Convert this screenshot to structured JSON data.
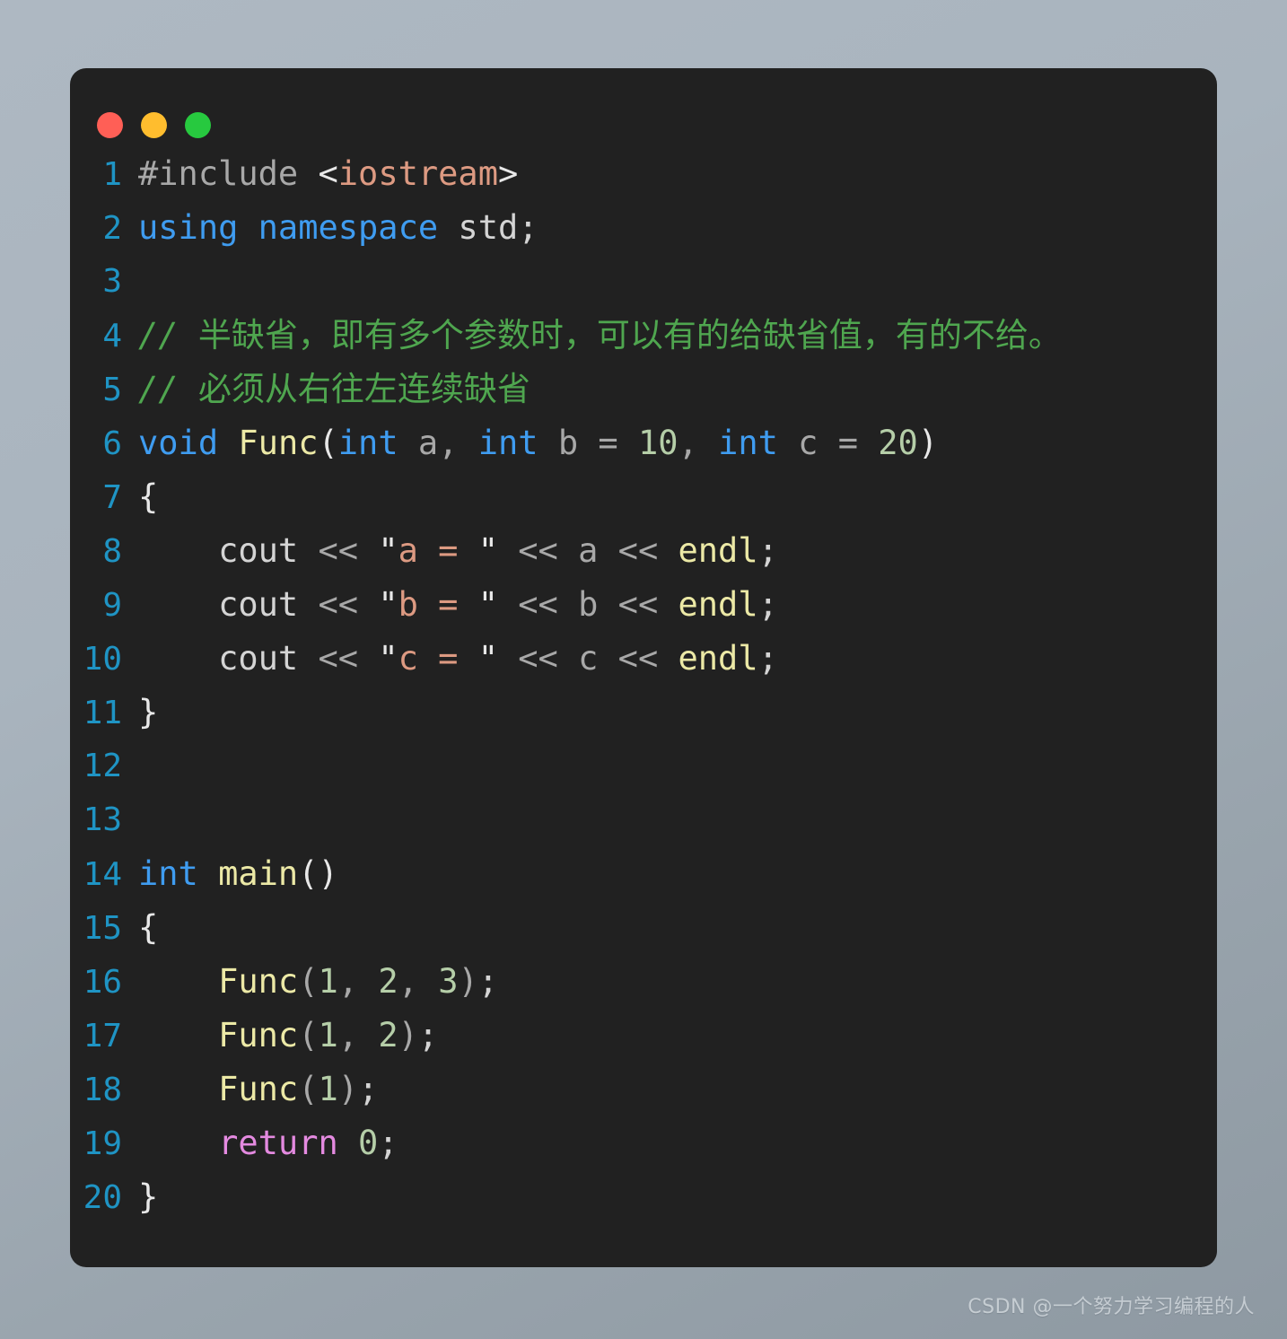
{
  "window": {
    "controls": [
      {
        "name": "close",
        "color": "#ff5f56"
      },
      {
        "name": "minimize",
        "color": "#ffbd2e"
      },
      {
        "name": "maximize",
        "color": "#27c93f"
      }
    ]
  },
  "editor": {
    "language": "C++",
    "theme_background": "#212121",
    "line_number_color": "#1f94c4",
    "first_line_number": 1,
    "last_line_number": 20,
    "line_numbers": [
      "1",
      "2",
      "3",
      "4",
      "5",
      "6",
      "7",
      "8",
      "9",
      "10",
      "11",
      "12",
      "13",
      "14",
      "15",
      "16",
      "17",
      "18",
      "19",
      "20"
    ],
    "lines": [
      {
        "n": "1",
        "text": "#include <iostream>"
      },
      {
        "n": "2",
        "text": "using namespace std;"
      },
      {
        "n": "3",
        "text": ""
      },
      {
        "n": "4",
        "text": "// 半缺省，即有多个参数时，可以有的给缺省值，有的不给。"
      },
      {
        "n": "5",
        "text": "// 必须从右往左连续缺省"
      },
      {
        "n": "6",
        "text": "void Func(int a, int b = 10, int c = 20)"
      },
      {
        "n": "7",
        "text": "{"
      },
      {
        "n": "8",
        "text": "    cout << \"a = \" << a << endl;"
      },
      {
        "n": "9",
        "text": "    cout << \"b = \" << b << endl;"
      },
      {
        "n": "10",
        "text": "    cout << \"c = \" << c << endl;"
      },
      {
        "n": "11",
        "text": "}"
      },
      {
        "n": "12",
        "text": ""
      },
      {
        "n": "13",
        "text": ""
      },
      {
        "n": "14",
        "text": "int main()"
      },
      {
        "n": "15",
        "text": "{"
      },
      {
        "n": "16",
        "text": "    Func(1, 2, 3);"
      },
      {
        "n": "17",
        "text": "    Func(1, 2);"
      },
      {
        "n": "18",
        "text": "    Func(1);"
      },
      {
        "n": "19",
        "text": "    return 0;"
      },
      {
        "n": "20",
        "text": "}"
      }
    ],
    "tokens": {
      "l1": {
        "a": "#include ",
        "b": "<",
        "c": "iostream",
        "d": ">"
      },
      "l2": {
        "a": "using namespace",
        "b": " std;"
      },
      "l4": {
        "slashes": "// ",
        "comment": "半缺省，即有多个参数时，可以有的给缺省值，有的不给。"
      },
      "l5": {
        "slashes": "// ",
        "comment": "必须从右往左连续缺省"
      },
      "l6": {
        "a": "void",
        "b": " ",
        "c": "Func",
        "d": "(",
        "e": "int",
        "f": " a, ",
        "g": "int",
        "h": " b = ",
        "i": "10",
        "j": ", ",
        "k": "int",
        "l": " c = ",
        "m": "20",
        "n": ")"
      },
      "l7": {
        "a": "{"
      },
      "l8": {
        "indent": "    ",
        "a": "cout",
        "b": " << ",
        "q1": "\"",
        "s": "a = ",
        "q2": "\"",
        "c": " << ",
        "v": "a",
        "d": " << ",
        "e": "endl",
        "f": ";"
      },
      "l9": {
        "indent": "    ",
        "a": "cout",
        "b": " << ",
        "q1": "\"",
        "s": "b = ",
        "q2": "\"",
        "c": " << ",
        "v": "b",
        "d": " << ",
        "e": "endl",
        "f": ";"
      },
      "l10": {
        "indent": "    ",
        "a": "cout",
        "b": " << ",
        "q1": "\"",
        "s": "c = ",
        "q2": "\"",
        "c": " << ",
        "v": "c",
        "d": " << ",
        "e": "endl",
        "f": ";"
      },
      "l11": {
        "a": "}"
      },
      "l14": {
        "a": "int",
        "b": " ",
        "c": "main",
        "d": "()"
      },
      "l15": {
        "a": "{"
      },
      "l16": {
        "indent": "    ",
        "a": "Func",
        "b": "(",
        "n1": "1",
        "c": ", ",
        "n2": "2",
        "d": ", ",
        "n3": "3",
        "e": ")",
        "f": ";"
      },
      "l17": {
        "indent": "    ",
        "a": "Func",
        "b": "(",
        "n1": "1",
        "c": ", ",
        "n2": "2",
        "e": ")",
        "f": ";"
      },
      "l18": {
        "indent": "    ",
        "a": "Func",
        "b": "(",
        "n1": "1",
        "e": ")",
        "f": ";"
      },
      "l19": {
        "indent": "    ",
        "a": "return",
        "b": " ",
        "n1": "0",
        "f": ";"
      },
      "l20": {
        "a": "}"
      }
    }
  },
  "watermark": {
    "text": "CSDN @一个努力学习编程的人"
  }
}
